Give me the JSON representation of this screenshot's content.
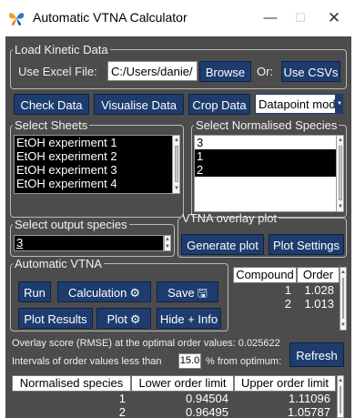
{
  "window": {
    "title": "Automatic VTNA Calculator",
    "minimize_glyph": "—",
    "maximize_glyph": "☐",
    "close_glyph": "✕",
    "app_icon": "butterfly-icon"
  },
  "colors": {
    "background": "#4c4c4c",
    "button": "#1e3c6e",
    "selection": "#000000"
  },
  "load_data": {
    "legend": "Load Kinetic Data",
    "excel_label": "Use Excel File:",
    "file_path": "C:/Users/danie/",
    "browse_label": "Browse",
    "or_label": "Or:",
    "csv_label": "Use CSVs"
  },
  "toolbar": {
    "check_label": "Check Data",
    "visualise_label": "Visualise Data",
    "crop_label": "Crop Data",
    "mode_value": "Datapoint mode"
  },
  "sheets": {
    "legend": "Select Sheets",
    "items": [
      "EtOH experiment 1",
      "EtOH experiment 2",
      "EtOH experiment 3",
      "EtOH experiment 4"
    ]
  },
  "normalised": {
    "legend": "Select Normalised Species",
    "items": [
      "3",
      "1",
      "2"
    ]
  },
  "output_species": {
    "legend": "Select output species",
    "value": "3"
  },
  "overlay": {
    "legend": "VTNA overlay plot",
    "generate_label": "Generate plot",
    "settings_label": "Plot Settings"
  },
  "auto_vtna": {
    "legend": "Automatic VTNA",
    "run_label": "Run",
    "calculation_label": "Calculation",
    "save_label": "Save",
    "plot_results_label": "Plot Results",
    "plot_label": "Plot",
    "hide_label": "Hide + Info",
    "gear_icon": "⚙",
    "save_icon": "🖫"
  },
  "orders_table": {
    "headers": [
      "Compound",
      "Order"
    ],
    "rows": [
      [
        "1",
        "1.028"
      ],
      [
        "2",
        "1.013"
      ]
    ]
  },
  "overlay_score": {
    "line1": "Overlay score (RMSE) at the optimal order values: 0.025622",
    "line2_pre": "Intervals of order values less than",
    "threshold": "15.0",
    "line2_post": "% from optimum:",
    "refresh_label": "Refresh"
  },
  "limits_table": {
    "headers": [
      "Normalised species",
      "Lower order limit",
      "Upper order limit"
    ],
    "rows": [
      [
        "1",
        "0.94504",
        "1.11096"
      ],
      [
        "2",
        "0.96495",
        "1.05787"
      ]
    ]
  }
}
